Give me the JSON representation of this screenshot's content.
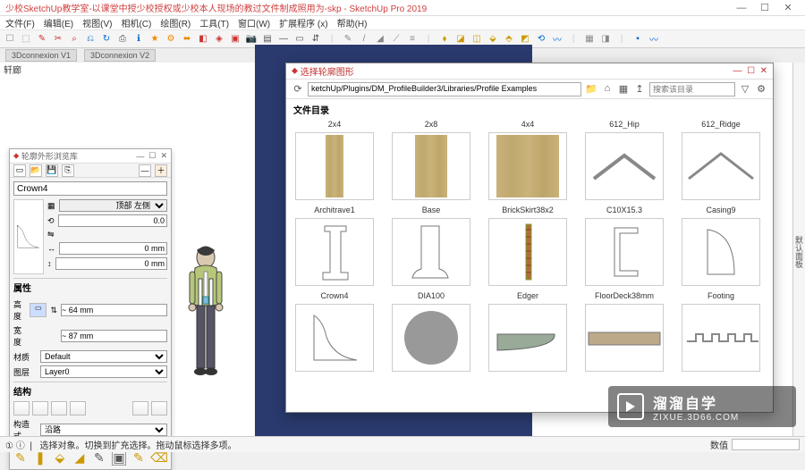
{
  "app": {
    "title": "少校SketchUp教学室-以课堂中授少校授权或少校本人现场的教过文件制成照用为-skp - SketchUp Pro 2019",
    "min": "—",
    "max": "☐",
    "close": "✕"
  },
  "menu": [
    "文件(F)",
    "编辑(E)",
    "视图(V)",
    "相机(C)",
    "绘图(R)",
    "工具(T)",
    "窗口(W)",
    "扩展程序 (x)",
    "帮助(H)"
  ],
  "toolbar_icons": [
    "☐",
    "⬚",
    "✎",
    "✂",
    "⌕",
    "⎌",
    "↻",
    "⎙",
    "ℹ",
    "★",
    "⚙",
    "⬌",
    "◧",
    "◈",
    "▣",
    "📷",
    "▤",
    "—",
    "▭",
    "⇵",
    "|",
    "✎",
    "/",
    "◢",
    "⟋",
    "≡",
    "|",
    "⬧",
    "◪",
    "◫",
    "⬙",
    "⬘",
    "◩",
    "⟲",
    "〰",
    "|",
    "▦",
    "◨",
    "|",
    "▪",
    "〰"
  ],
  "tabs": {
    "a": "3Dconnexion V1",
    "b": "3Dconnexion V2"
  },
  "viewport_label": "轩廊",
  "rightstrip": "默认面板",
  "statusbar": {
    "icons": "① ⓘ ❘",
    "hint": "选择对象。切换到扩充选择。拖动鼠标选择多项。",
    "measure_label": "数值"
  },
  "profile_dialog": {
    "title": "轮廓外形浏览库",
    "name": "Crown4",
    "placement": "顶部 左侧",
    "rot": "0.0",
    "offx": "0 mm",
    "offy": "0 mm",
    "section_props": "属性",
    "h_label": "高度",
    "h": "~ 64 mm",
    "w_label": "宽度",
    "w": "~ 87 mm",
    "mat_label": "材质",
    "mat": "Default",
    "layer_label": "图层",
    "layer": "Layer0",
    "section_struct": "结构",
    "mode_label": "构造式",
    "mode": "沿路"
  },
  "library_dialog": {
    "title": "选择轮廓图形",
    "path": "ketchUp/Plugins/DM_ProfileBuilder3/Libraries/Profile Examples",
    "search_ph": "搜索该目录",
    "heading": "文件目录",
    "items": [
      [
        "2x4",
        "2x8",
        "4x4",
        "612_Hip",
        "612_Ridge"
      ],
      [
        "Architrave1",
        "Base",
        "BrickSkirt38x2",
        "C10X15.3",
        "Casing9"
      ],
      [
        "Crown4",
        "DIA100",
        "Edger",
        "FloorDeck38mm",
        "Footing"
      ]
    ]
  },
  "watermark": {
    "brand": "溜溜自学",
    "url": "ZIXUE.3D66.COM"
  }
}
